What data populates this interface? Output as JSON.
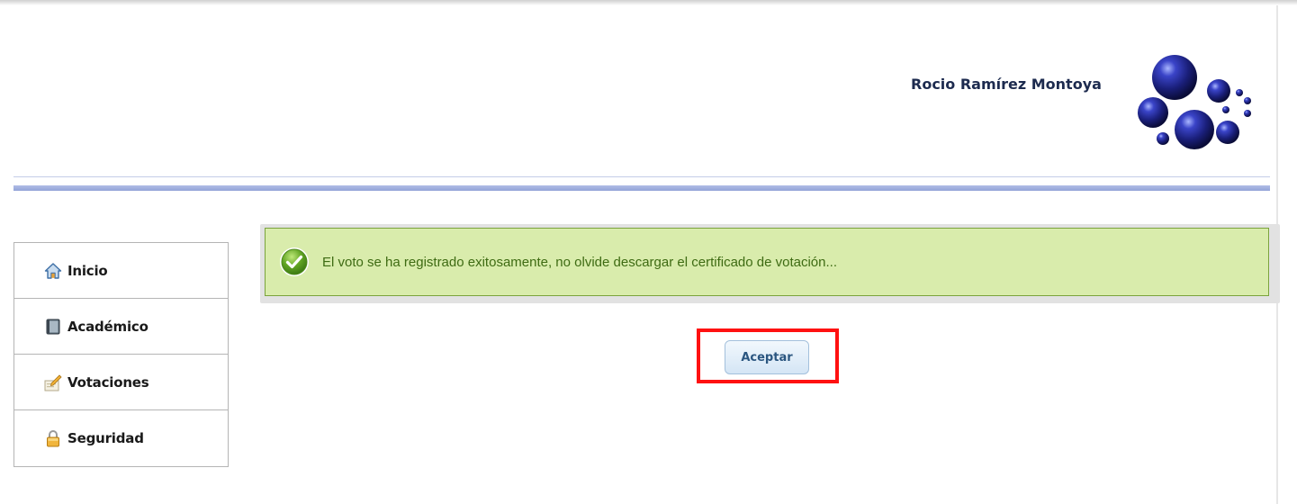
{
  "header": {
    "user_name": "Rocio Ramírez Montoya",
    "logo": "blue-bubbles-logo"
  },
  "sidebar": {
    "items": [
      {
        "label": "Inicio",
        "icon": "home-icon"
      },
      {
        "label": "Académico",
        "icon": "book-icon"
      },
      {
        "label": "Votaciones",
        "icon": "ballot-icon"
      },
      {
        "label": "Seguridad",
        "icon": "lock-icon"
      }
    ]
  },
  "message": {
    "text": "El voto se ha registrado exitosamente, no olvide descargar el certificado de votación...",
    "icon": "success-check-icon"
  },
  "dialog": {
    "accept_label": "Aceptar"
  },
  "colors": {
    "success_bg": "#d9ecac",
    "success_border": "#7aa33c",
    "success_text": "#3e6b13",
    "highlight": "#ff1111",
    "header_rule": "#93a3d8",
    "button_text": "#2b5680"
  }
}
